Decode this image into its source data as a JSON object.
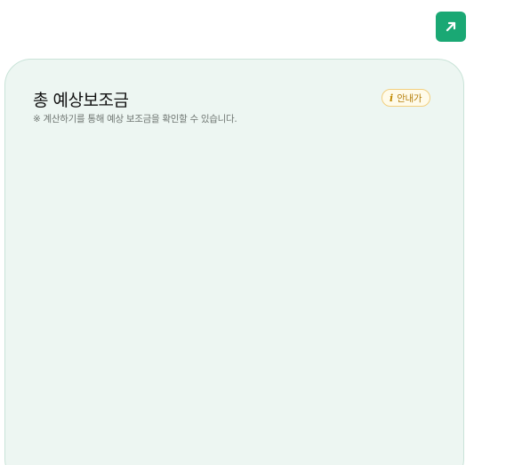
{
  "header": {
    "expand_icon": "arrow-up-right-icon",
    "accent_color": "#1aa874"
  },
  "card": {
    "title": "총 예상보조금",
    "note": "※ 계산하기를 통해 예상 보조금을 확인할 수 있습니다.",
    "guide_badge": {
      "icon_glyph": "i",
      "label": "안내가"
    },
    "background_color": "#edf6f2"
  }
}
